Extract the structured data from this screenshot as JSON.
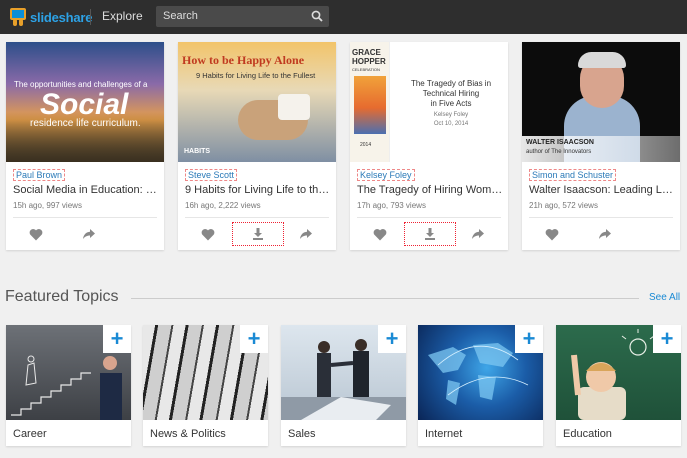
{
  "header": {
    "logo_text": "slideshare",
    "explore_label": "Explore",
    "search_placeholder": "Search"
  },
  "cards": [
    {
      "thumb_lines": [
        "The opportunities and challenges of a",
        "Social",
        "residence life curriculum."
      ],
      "author": "Paul Brown",
      "title": "Social Media in Education: …",
      "meta": "15h ago, 997 views"
    },
    {
      "thumb_lines": [
        "How to be Happy Alone",
        "9 Habits for Living Life to the Fullest",
        "HABITS"
      ],
      "author": "Steve Scott",
      "title": "9 Habits for Living Life to th…",
      "meta": "16h ago, 2,222 views"
    },
    {
      "thumb_lines": [
        "GRACE",
        "HOPPER",
        "CELEBRATION",
        "2014",
        "The Tragedy of Bias in",
        "Technical Hiring",
        "in Five Acts",
        "Kelsey Foley",
        "Oct 10, 2014"
      ],
      "author": "Kelsey Foley",
      "title": "The Tragedy of Hiring Wome…",
      "meta": "17h ago, 793 views"
    },
    {
      "thumb_lines": [
        "WALTER ISAACSON",
        "author of The Innovators"
      ],
      "author": "Simon and Schuster",
      "title": "Walter Isaacson: Leading La…",
      "meta": "21h ago, 572 views"
    }
  ],
  "featured": {
    "heading": "Featured Topics",
    "see_all": "See All",
    "topics": [
      "Career",
      "News & Politics",
      "Sales",
      "Internet",
      "Education"
    ]
  },
  "colors": {
    "accent": "#1a8ad4",
    "topbar": "#2e2e2e"
  }
}
